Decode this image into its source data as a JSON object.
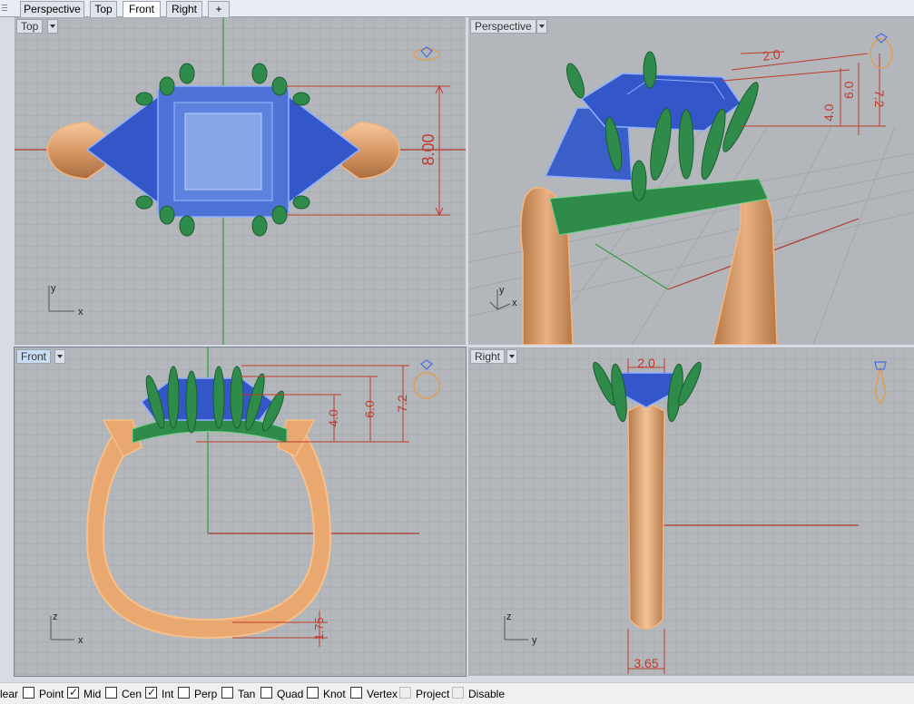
{
  "tabs": [
    {
      "label": "Perspective",
      "active": false
    },
    {
      "label": "Top",
      "active": false
    },
    {
      "label": "Front",
      "active": true
    },
    {
      "label": "Right",
      "active": false
    }
  ],
  "add_tab_label": "+",
  "viewports": {
    "top": {
      "title": "Top",
      "dimension": "8.00",
      "axis_x": "x",
      "axis_y": "y"
    },
    "perspective": {
      "title": "Perspective",
      "dims": [
        "2.0",
        "7.2",
        "6.0",
        "4.0"
      ],
      "axis_x": "x",
      "axis_y": "y"
    },
    "front": {
      "title": "Front",
      "dims": [
        "7.2",
        "6.0",
        "4.0",
        "1.75"
      ],
      "axis_x": "x",
      "axis_y": "z"
    },
    "right": {
      "title": "Right",
      "dims": [
        "2.0",
        "3.65"
      ],
      "axis_x": "y",
      "axis_y": "z"
    }
  },
  "osnap": {
    "clear_label": "lear",
    "items": [
      {
        "label": "Point",
        "checked": false,
        "disabled": false
      },
      {
        "label": "Mid",
        "checked": true,
        "disabled": false
      },
      {
        "label": "Cen",
        "checked": false,
        "disabled": false
      },
      {
        "label": "Int",
        "checked": true,
        "disabled": false
      },
      {
        "label": "Perp",
        "checked": false,
        "disabled": false
      },
      {
        "label": "Tan",
        "checked": false,
        "disabled": false
      },
      {
        "label": "Quad",
        "checked": false,
        "disabled": false
      },
      {
        "label": "Knot",
        "checked": false,
        "disabled": false
      },
      {
        "label": "Vertex",
        "checked": false,
        "disabled": false
      },
      {
        "label": "Project",
        "checked": false,
        "disabled": true
      },
      {
        "label": "Disable",
        "checked": false,
        "disabled": true
      }
    ]
  },
  "colors": {
    "gold": "#e8a870",
    "gold_dark": "#b57848",
    "sapphire": "#3a5fc8",
    "emerald": "#2e8b4a",
    "dimension": "#c0392b",
    "grid_bg": "#b3b6ba"
  }
}
